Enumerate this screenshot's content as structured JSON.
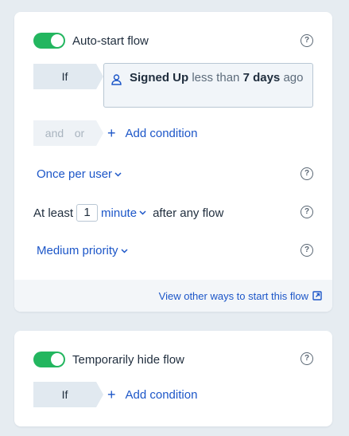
{
  "colors": {
    "background": "#e6ecf1",
    "card": "#ffffff",
    "toggle_on": "#23b65f",
    "link": "#1c56c8",
    "text": "#1f2d3d",
    "muted": "#5d6c7b",
    "tag_bg": "#e1e9f0"
  },
  "start_card": {
    "toggle": {
      "label": "Auto-start flow",
      "on": true,
      "help_icon": "question-circle-icon"
    },
    "condition": {
      "if_label": "If",
      "icon": "user-icon",
      "event_name": "Signed Up",
      "comparator": "less than",
      "amount": "7 days",
      "suffix": "ago"
    },
    "logic": {
      "and_label": "and",
      "or_label": "or"
    },
    "add_condition_label": "Add condition",
    "frequency": {
      "label": "Once per user",
      "help_icon": "question-circle-icon"
    },
    "spacing": {
      "prefix": "At least",
      "value": "1",
      "unit": "minute",
      "suffix": "after any flow",
      "help_icon": "question-circle-icon"
    },
    "priority": {
      "label": "Medium priority",
      "help_icon": "question-circle-icon"
    },
    "footer_link": {
      "label": "View other ways to start this flow",
      "icon": "external-link-icon"
    }
  },
  "hide_card": {
    "toggle": {
      "label": "Temporarily hide flow",
      "on": true,
      "help_icon": "question-circle-icon"
    },
    "if_label": "If",
    "add_condition_label": "Add condition"
  }
}
